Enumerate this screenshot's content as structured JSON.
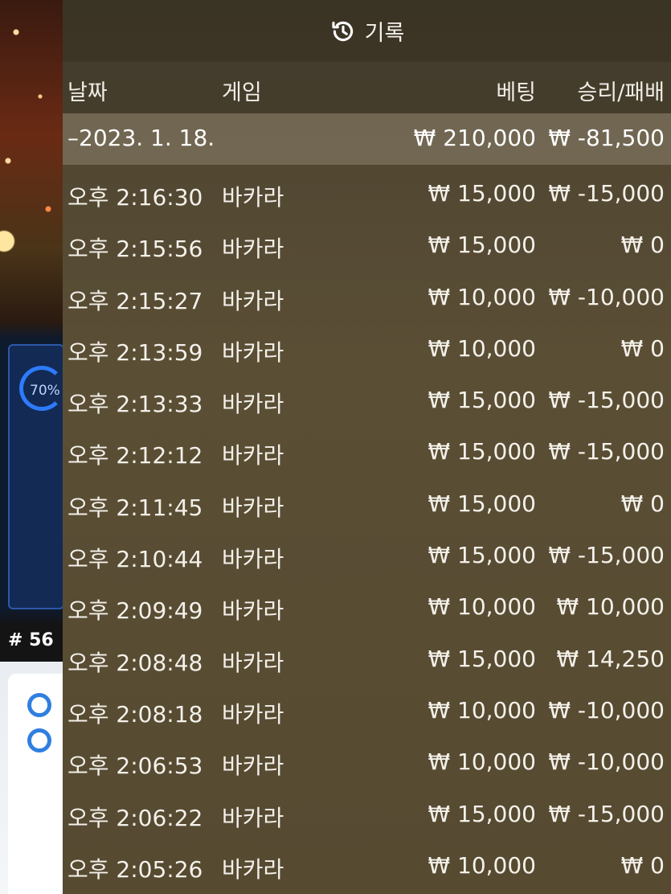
{
  "background": {
    "progress_label": "70%",
    "round_label": "# 56"
  },
  "history": {
    "title": "기록",
    "columns": {
      "date": "날짜",
      "game": "게임",
      "bet": "베팅",
      "win_loss": "승리/패배"
    },
    "date_group": {
      "label": "–2023. 1. 18.",
      "total_bet": "₩ 210,000",
      "total_win_loss": "₩ -81,500"
    },
    "rows": [
      {
        "time": "오후 2:16:30",
        "game": "바카라",
        "bet": "₩ 15,000",
        "result": "₩ -15,000"
      },
      {
        "time": "오후 2:15:56",
        "game": "바카라",
        "bet": "₩ 15,000",
        "result": "₩ 0"
      },
      {
        "time": "오후 2:15:27",
        "game": "바카라",
        "bet": "₩ 10,000",
        "result": "₩ -10,000"
      },
      {
        "time": "오후 2:13:59",
        "game": "바카라",
        "bet": "₩ 10,000",
        "result": "₩ 0"
      },
      {
        "time": "오후 2:13:33",
        "game": "바카라",
        "bet": "₩ 15,000",
        "result": "₩ -15,000"
      },
      {
        "time": "오후 2:12:12",
        "game": "바카라",
        "bet": "₩ 15,000",
        "result": "₩ -15,000"
      },
      {
        "time": "오후 2:11:45",
        "game": "바카라",
        "bet": "₩ 15,000",
        "result": "₩ 0"
      },
      {
        "time": "오후 2:10:44",
        "game": "바카라",
        "bet": "₩ 15,000",
        "result": "₩ -15,000"
      },
      {
        "time": "오후 2:09:49",
        "game": "바카라",
        "bet": "₩ 10,000",
        "result": "₩ 10,000"
      },
      {
        "time": "오후 2:08:48",
        "game": "바카라",
        "bet": "₩ 15,000",
        "result": "₩ 14,250"
      },
      {
        "time": "오후 2:08:18",
        "game": "바카라",
        "bet": "₩ 10,000",
        "result": "₩ -10,000"
      },
      {
        "time": "오후 2:06:53",
        "game": "바카라",
        "bet": "₩ 10,000",
        "result": "₩ -10,000"
      },
      {
        "time": "오후 2:06:22",
        "game": "바카라",
        "bet": "₩ 15,000",
        "result": "₩ -15,000"
      },
      {
        "time": "오후 2:05:26",
        "game": "바카라",
        "bet": "₩ 10,000",
        "result": "₩ 0"
      }
    ]
  }
}
